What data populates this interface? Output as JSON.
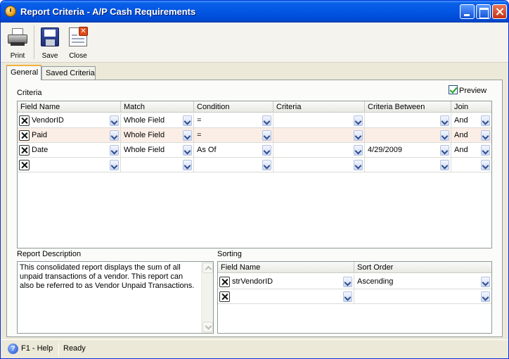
{
  "window": {
    "title": "Report Criteria - A/P Cash Requirements"
  },
  "toolbar": {
    "print_label": "Print",
    "save_label": "Save",
    "close_label": "Close"
  },
  "tabs": [
    {
      "label": "General",
      "active": true
    },
    {
      "label": "Saved Criteria",
      "active": false
    }
  ],
  "criteria": {
    "section_label": "Criteria",
    "preview_label": "Preview",
    "preview_checked": true,
    "columns": [
      "Field Name",
      "Match",
      "Condition",
      "Criteria",
      "Criteria Between",
      "Join"
    ],
    "rows": [
      [
        "VendorID",
        "Whole Field",
        "=",
        "",
        "",
        "And"
      ],
      [
        "Paid",
        "Whole Field",
        "=",
        "",
        "",
        "And"
      ],
      [
        "Date",
        "Whole Field",
        "As Of",
        "",
        "4/29/2009",
        "And"
      ],
      [
        "",
        "",
        "",
        "",
        "",
        ""
      ]
    ]
  },
  "description": {
    "section_label": "Report Description",
    "text": "This consolidated report displays the sum of all unpaid transactions of a vendor. This report can also be referred to as Vendor Unpaid Transactions."
  },
  "sorting": {
    "section_label": "Sorting",
    "columns": [
      "Field Name",
      "Sort Order"
    ],
    "rows": [
      [
        "strVendorID",
        "Ascending"
      ],
      [
        "",
        ""
      ]
    ]
  },
  "statusbar": {
    "help_label": "F1 - Help",
    "status": "Ready"
  },
  "colors": {
    "titlebar": "#0256e2",
    "alt_row": "#fbeee6",
    "check": "#21a121"
  }
}
